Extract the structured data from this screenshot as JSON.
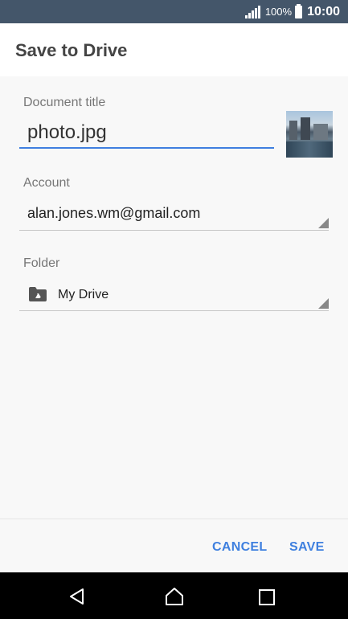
{
  "status_bar": {
    "battery_percent": "100%",
    "time": "10:00",
    "icons": [
      "signal-icon",
      "battery-icon"
    ]
  },
  "header": {
    "title": "Save to Drive"
  },
  "form": {
    "document_title": {
      "label": "Document title",
      "value": "photo.jpg"
    },
    "account": {
      "label": "Account",
      "value": "alan.jones.wm@gmail.com"
    },
    "folder": {
      "label": "Folder",
      "value": "My Drive",
      "icon": "drive-folder-icon"
    }
  },
  "actions": {
    "cancel_label": "CANCEL",
    "save_label": "SAVE",
    "accent_color": "#3f80df"
  },
  "navigation": {
    "icons": [
      "back-icon",
      "home-icon",
      "recents-icon"
    ]
  },
  "colors": {
    "status_bar": "#44566a",
    "header_bg": "#ffffff",
    "body_bg": "#f8f8f8",
    "input_underline": "#3f7fe0"
  }
}
